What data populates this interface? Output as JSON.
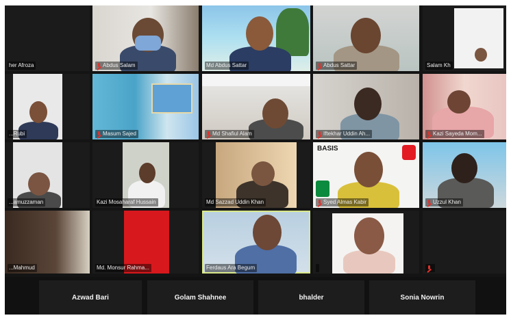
{
  "meeting": {
    "participants": [
      {
        "label": "her Afroza"
      },
      {
        "label": "Abdus Salam"
      },
      {
        "label": "Md Abdus Sattar"
      },
      {
        "label": "Abdus Sattar"
      },
      {
        "label": "Salam Kh"
      },
      {
        "label": "...Rubi"
      },
      {
        "label": "Masum Sajed"
      },
      {
        "label": "Md Shafiul Alam"
      },
      {
        "label": "Iftekhar Uddin Ah..."
      },
      {
        "label": "Kazi Sayeda Mom..."
      },
      {
        "label": "...amuzzaman"
      },
      {
        "label": "Kazi Mosaharaf Hussain"
      },
      {
        "label": "Md Sazzad Uddin Khan"
      },
      {
        "label": "Syed Almas Kabir"
      },
      {
        "label": "Uzzul Khan"
      },
      {
        "label": "...Mahmud"
      },
      {
        "label": "Md. Monsur Rahma..."
      },
      {
        "label": "Ferdaus Ara Begum"
      },
      {
        "label": ""
      },
      {
        "label": ""
      }
    ],
    "name_only_tiles": [
      {
        "label": "Azwad Bari"
      },
      {
        "label": "Golam Shahnee"
      },
      {
        "label": "bhalder"
      },
      {
        "label": "Sonia Nowrin"
      }
    ],
    "logo_text": "BASIS"
  }
}
